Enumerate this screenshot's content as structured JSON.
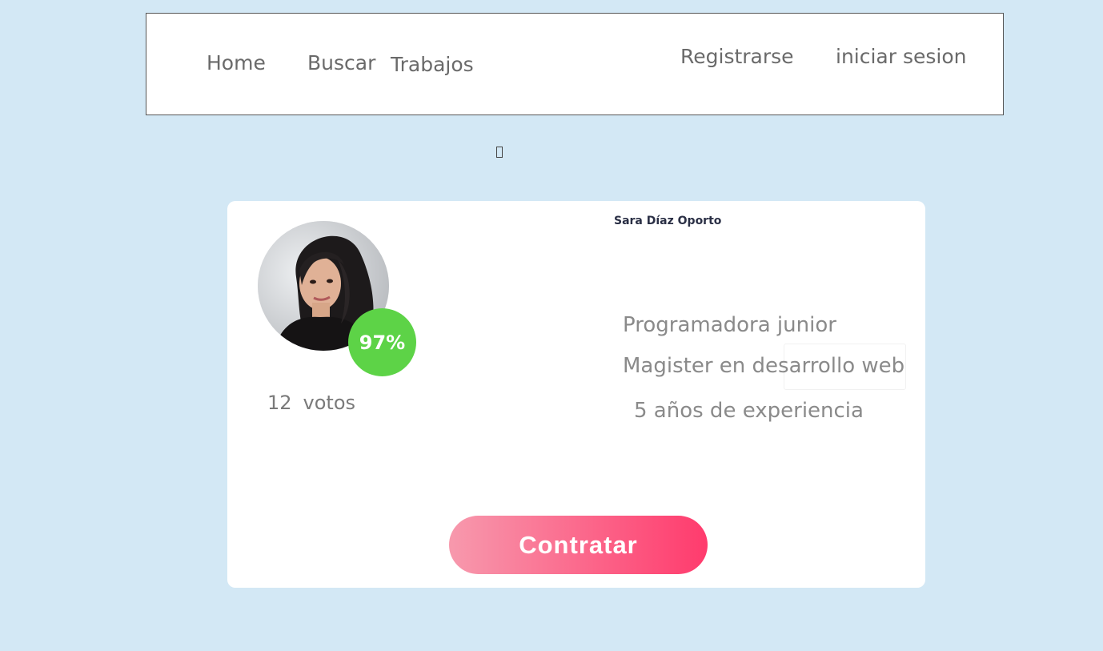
{
  "nav": {
    "home": "Home",
    "buscar": "Buscar",
    "trabajos": "Trabajos",
    "registrarse": "Registrarse",
    "login": "iniciar sesion"
  },
  "profile": {
    "name": "Sara Díaz Oporto",
    "score": "97%",
    "votes_count": "12",
    "votes_label": "votos",
    "role": "Programadora junior",
    "degree": "Magister en desarrollo web",
    "experience": "5 años de experiencia",
    "hire_label": "Contratar"
  },
  "colors": {
    "background": "#d3e8f5",
    "score_badge": "#5dd347",
    "button_gradient_start": "#f799ad",
    "button_gradient_end": "#ff3b6d"
  }
}
